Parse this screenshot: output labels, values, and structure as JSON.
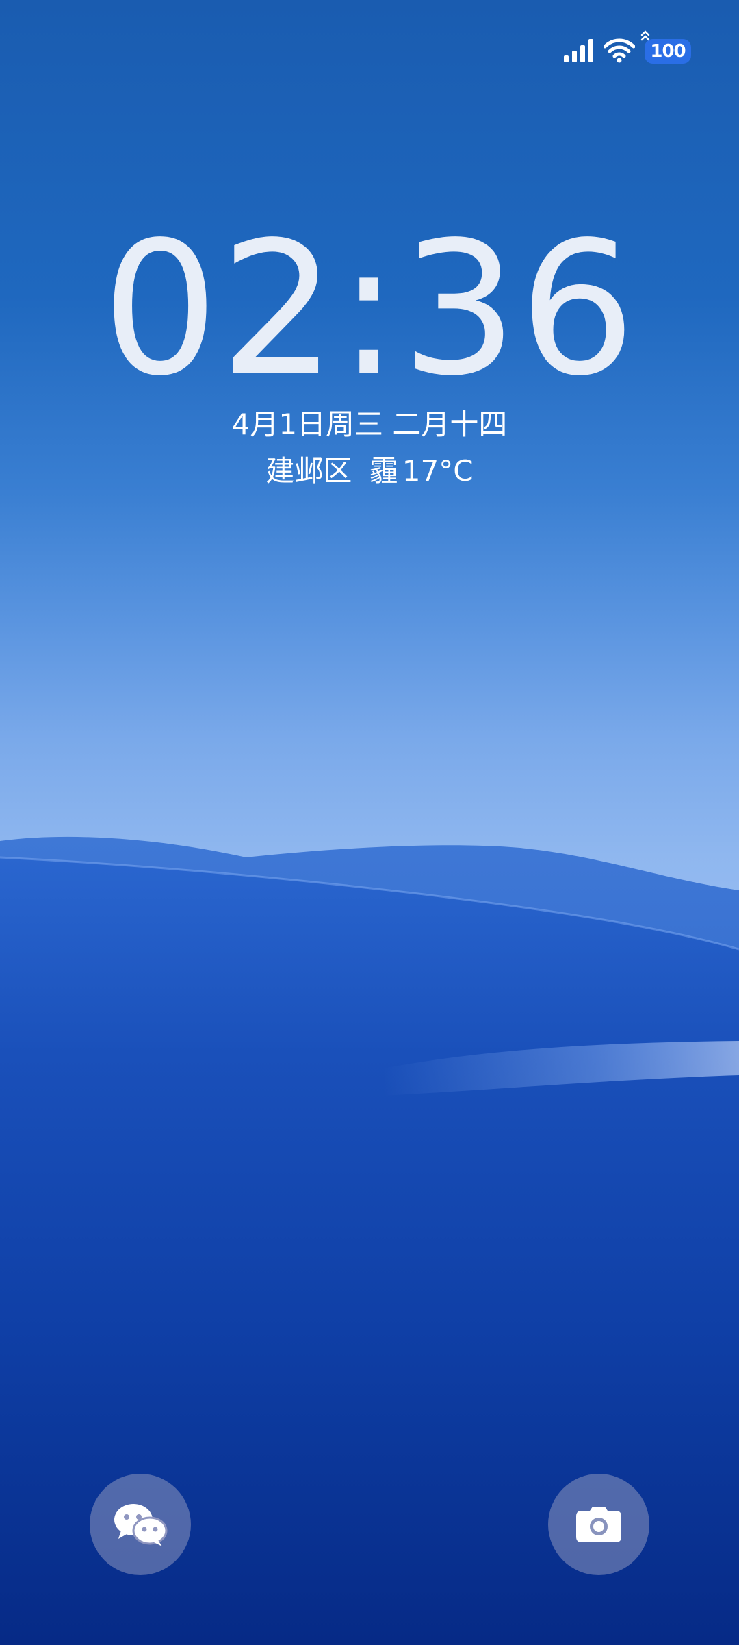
{
  "status_bar": {
    "signal_icon": "cellular-signal-icon",
    "wifi_icon": "wifi-icon",
    "charge_icon": "charging-arrows-icon",
    "battery_level": "100",
    "battery_color": "#2a6ee6"
  },
  "lockscreen": {
    "time": "02:36",
    "date": "4月1日周三 二月十四",
    "location": "建邺区",
    "weather": "霾",
    "temperature": "17°C"
  },
  "shortcuts": {
    "left": {
      "icon": "wechat-icon"
    },
    "right": {
      "icon": "camera-icon"
    }
  }
}
